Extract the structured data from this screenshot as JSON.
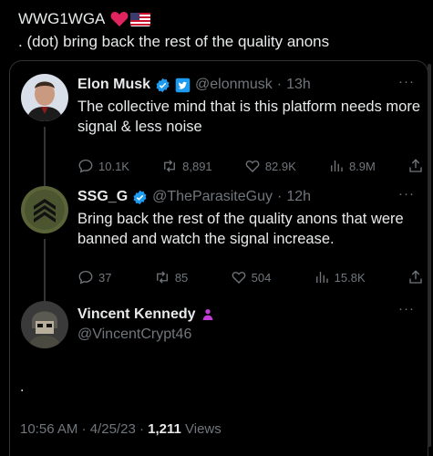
{
  "header": {
    "title": "WWG1WGA",
    "subtitle": ". (dot) bring back the rest of the quality anons"
  },
  "tweets": [
    {
      "name": "Elon Musk",
      "handle": "@elonmusk",
      "sep": "·",
      "time": "13h",
      "text": "The collective mind that is this platform needs more signal & less noise",
      "replies": "10.1K",
      "retweets": "8,891",
      "likes": "82.9K",
      "views": "8.9M"
    },
    {
      "name": "SSG_G",
      "handle": "@TheParasiteGuy",
      "sep": "·",
      "time": "12h",
      "text": "Bring back the rest of the quality anons that were banned and watch the signal increase.",
      "replies": "37",
      "retweets": "85",
      "likes": "504",
      "views": "15.8K"
    },
    {
      "name": "Vincent Kennedy",
      "handle": "@VincentCrypt46",
      "text": "."
    }
  ],
  "footer": {
    "time": "10:56 AM",
    "sep1": "·",
    "date": "4/25/23",
    "sep2": "·",
    "views_count": "1,211",
    "views_label": "Views"
  },
  "more_label": "···",
  "colors": {
    "background": "#000000",
    "text": "#e7e9ea",
    "muted": "#71767b",
    "verified_blue": "#1d9bf0",
    "purple_badge": "#c13dd6"
  },
  "icons": [
    "heart-icon",
    "us-flag-icon",
    "verified-icon",
    "twitter-badge-icon",
    "reply-icon",
    "retweet-icon",
    "like-icon",
    "views-icon",
    "share-icon",
    "more-icon",
    "affiliate-badge-icon"
  ]
}
